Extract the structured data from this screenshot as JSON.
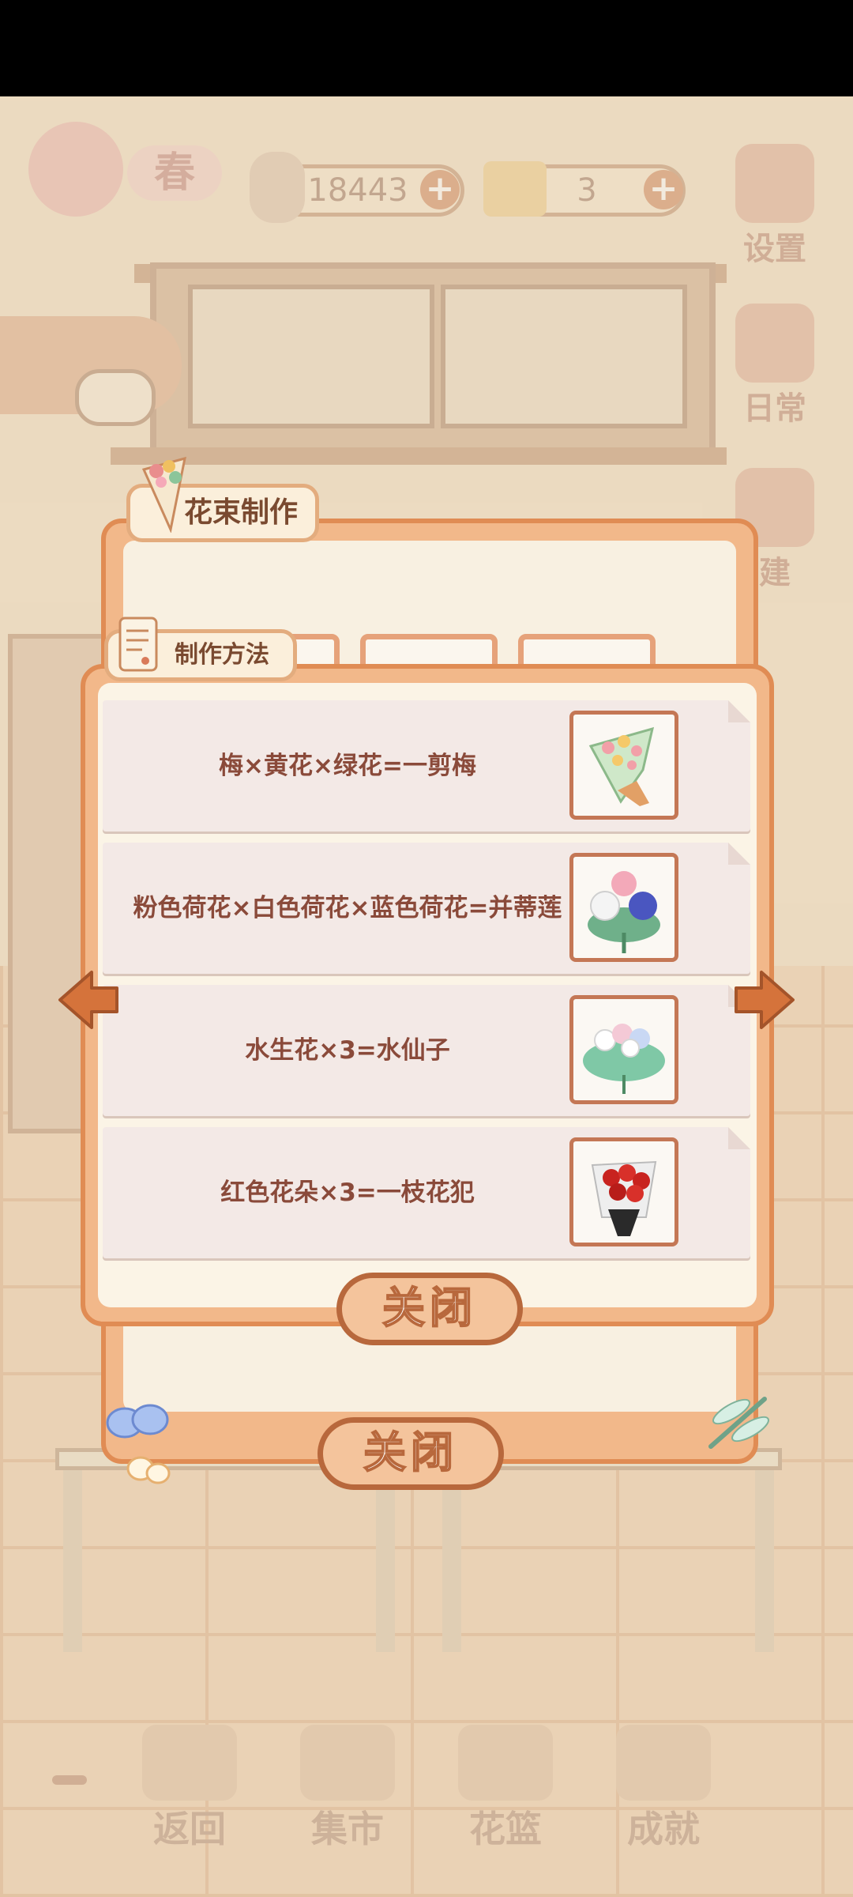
{
  "hud": {
    "season": "春",
    "fish_count": "18443",
    "cheese_count": "3",
    "settings_label": "设置",
    "daily_label": "日常",
    "build_label": "建"
  },
  "bottom_nav": [
    {
      "label": "返回"
    },
    {
      "label": "集市"
    },
    {
      "label": "花篮"
    },
    {
      "label": "成就"
    }
  ],
  "bouquet_dialog": {
    "title": "花束制作",
    "close_label": "关闭"
  },
  "recipe_dialog": {
    "title": "制作方法",
    "close_label": "关闭",
    "recipes": [
      {
        "text": "梅×黄花×绿花=一剪梅",
        "image": "plum-bouquet-image"
      },
      {
        "text": "粉色荷花×白色荷花×蓝色荷花=并蒂莲",
        "image": "lotus-bouquet-image"
      },
      {
        "text": "水生花×3=水仙子",
        "image": "water-flower-bouquet-image"
      },
      {
        "text": "红色花朵×3=一枝花犯",
        "image": "red-rose-bouquet-image"
      }
    ]
  },
  "colors": {
    "panel_border": "#e08c54",
    "panel_fill": "#f2b88a",
    "recipe_text": "#8a4a3a",
    "button_border": "#b8683c"
  }
}
